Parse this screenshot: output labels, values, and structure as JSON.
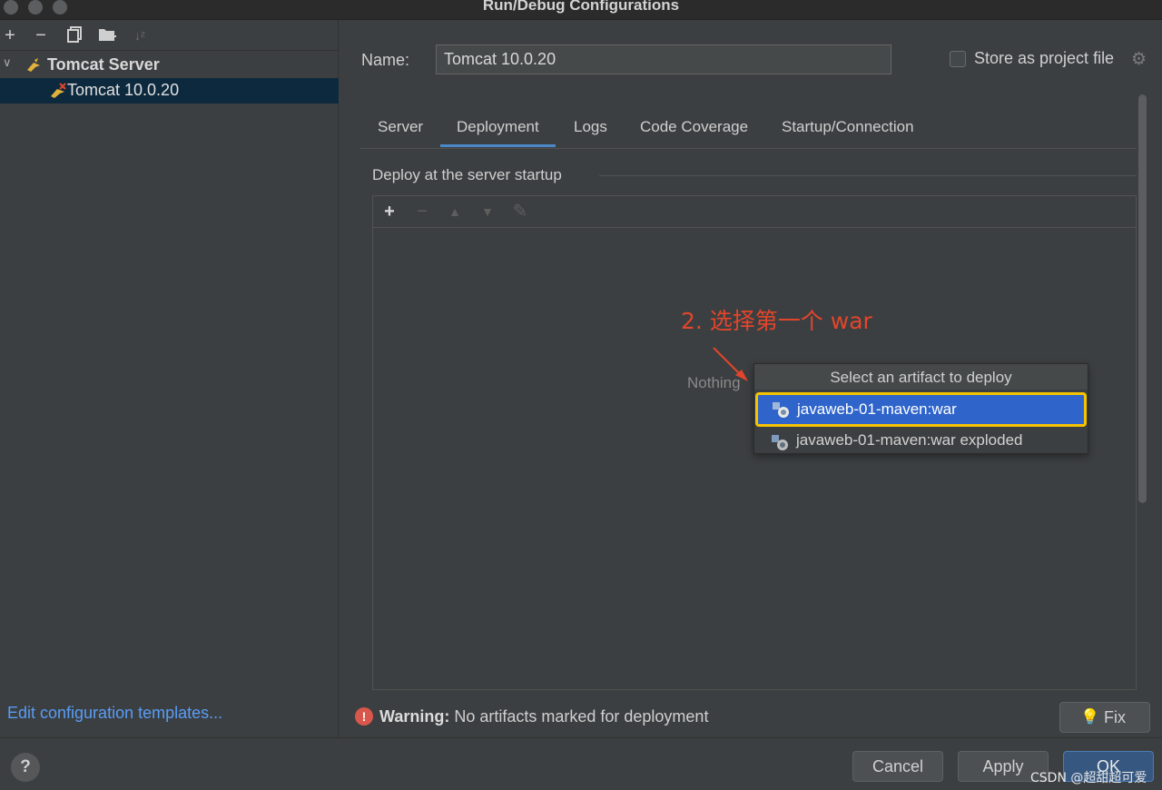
{
  "window": {
    "title": "Run/Debug Configurations"
  },
  "left": {
    "group_label": "Tomcat Server",
    "item_label": "Tomcat 10.0.20",
    "edit_templates": "Edit configuration templates..."
  },
  "form": {
    "name_label": "Name:",
    "name_value": "Tomcat 10.0.20",
    "store_label": "Store as project file"
  },
  "tabs": [
    "Server",
    "Deployment",
    "Logs",
    "Code Coverage",
    "Startup/Connection"
  ],
  "deploy": {
    "title": "Deploy at the server startup",
    "empty_text": "Nothing"
  },
  "annotation": "2. 选择第一个 war",
  "popup": {
    "title": "Select an artifact to deploy",
    "items": [
      "javaweb-01-maven:war",
      "javaweb-01-maven:war exploded"
    ]
  },
  "warning": {
    "label": "Warning:",
    "message": " No artifacts marked for deployment",
    "fix_label": "Fix"
  },
  "buttons": {
    "cancel": "Cancel",
    "apply": "Apply",
    "ok": "OK"
  },
  "watermark": "CSDN @超甜超可爱",
  "colors": {
    "accent": "#2f65ca",
    "highlight": "#f6c300",
    "annotation": "#e2452b",
    "link": "#589df6"
  }
}
